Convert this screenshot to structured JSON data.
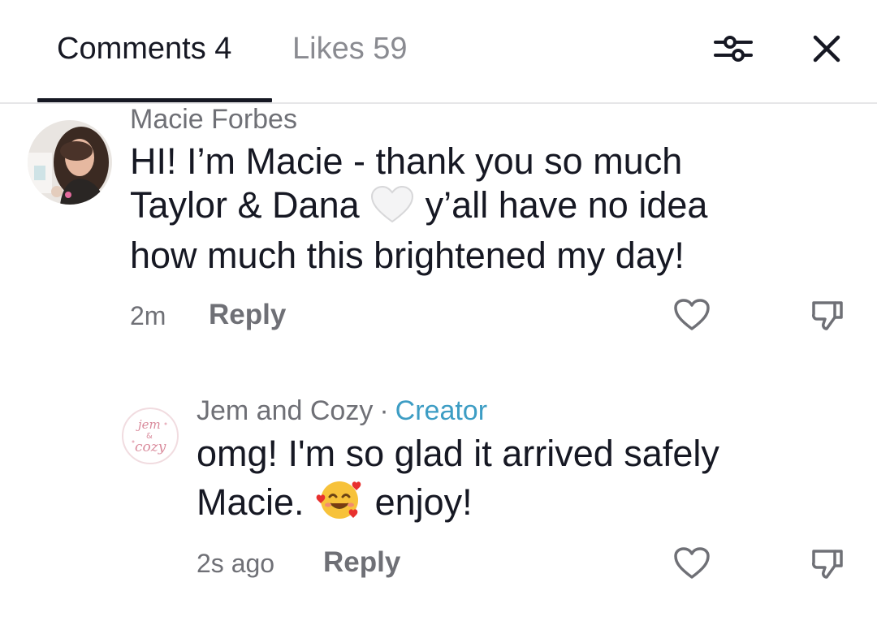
{
  "tabs": {
    "comments_label": "Comments 4",
    "likes_label": "Likes 59",
    "active": "comments"
  },
  "header": {
    "filter_icon": "sliders-icon",
    "close_icon": "close-icon"
  },
  "comments": [
    {
      "username": "Macie Forbes",
      "avatar_icon": "user-photo",
      "text_lines": [
        "HI! I’m Macie - thank you so much",
        "Taylor & Dana",
        "y’all have no idea",
        "how much this brightened my day!"
      ],
      "emoji": "white-heart-emoji",
      "time": "2m",
      "reply_label": "Reply"
    },
    {
      "username": "Jem and Cozy",
      "separator": "·",
      "badge": "Creator",
      "avatar_icon": "jem-and-cozy-logo",
      "logo_text": "jem & cozy",
      "text_lines": [
        "omg! I'm so glad it arrived safely",
        "Macie.",
        "enjoy!"
      ],
      "emoji": "smiling-face-with-hearts-emoji",
      "time": "2s ago",
      "reply_label": "Reply"
    }
  ],
  "colors": {
    "text_primary": "#161823",
    "text_secondary": "#6f7076",
    "creator_badge": "#3d9dc4",
    "divider": "#e6e6e8"
  }
}
